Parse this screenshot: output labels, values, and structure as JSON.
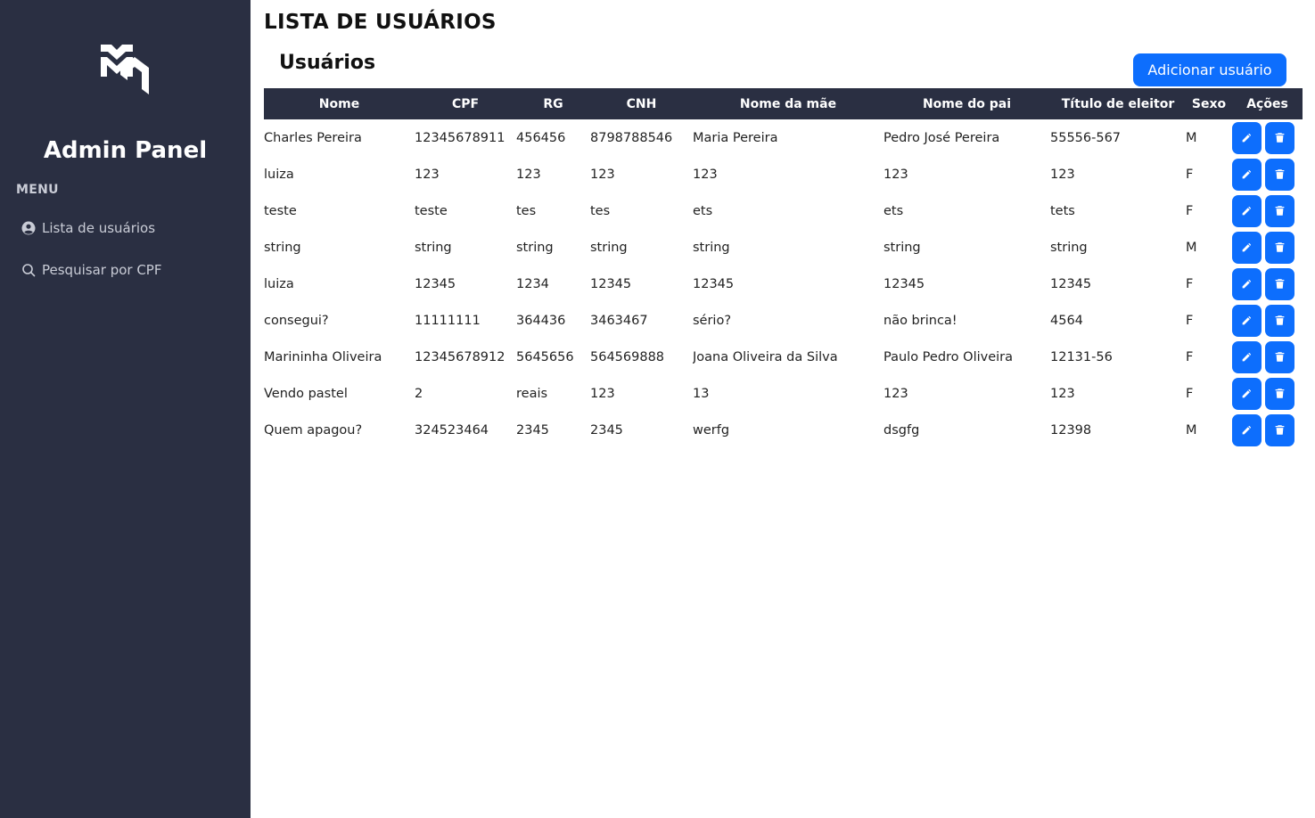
{
  "sidebar": {
    "brand": "Admin Panel",
    "menu_label": "MENU",
    "items": [
      {
        "label": "Lista de usuários",
        "icon": "user-circle-icon"
      },
      {
        "label": "Pesquisar por CPF",
        "icon": "search-icon"
      }
    ]
  },
  "header": {
    "page_title": "LISTA DE USUÁRIOS",
    "section_title": "Usuários",
    "add_button": "Adicionar usuário"
  },
  "table": {
    "columns": [
      "Nome",
      "CPF",
      "RG",
      "CNH",
      "Nome da mãe",
      "Nome do pai",
      "Título de eleitor",
      "Sexo",
      "Ações"
    ],
    "rows": [
      [
        "Charles Pereira",
        "12345678911",
        "456456",
        "8798788546",
        "Maria Pereira",
        "Pedro José Pereira",
        "55556-567",
        "M"
      ],
      [
        "luiza",
        "123",
        "123",
        "123",
        "123",
        "123",
        "123",
        "F"
      ],
      [
        "teste",
        "teste",
        "tes",
        "tes",
        "ets",
        "ets",
        "tets",
        "F"
      ],
      [
        "string",
        "string",
        "string",
        "string",
        "string",
        "string",
        "string",
        "M"
      ],
      [
        "luiza",
        "12345",
        "1234",
        "12345",
        "12345",
        "12345",
        "12345",
        "F"
      ],
      [
        "consegui?",
        "11111111",
        "364436",
        "3463467",
        "sério?",
        "não brinca!",
        "4564",
        "F"
      ],
      [
        "Marininha Oliveira",
        "12345678912",
        "5645656",
        "564569888",
        "Joana Oliveira da Silva",
        "Paulo Pedro Oliveira",
        "12131-56",
        "F"
      ],
      [
        "Vendo pastel",
        "2",
        "reais",
        "123",
        "13",
        "123",
        "123",
        "F"
      ],
      [
        "Quem apagou?",
        "324523464",
        "2345",
        "2345",
        "werfg",
        "dsgfg",
        "12398",
        "M"
      ]
    ]
  },
  "colors": {
    "sidebar_bg": "#2a2f42",
    "accent": "#0d6efd"
  }
}
